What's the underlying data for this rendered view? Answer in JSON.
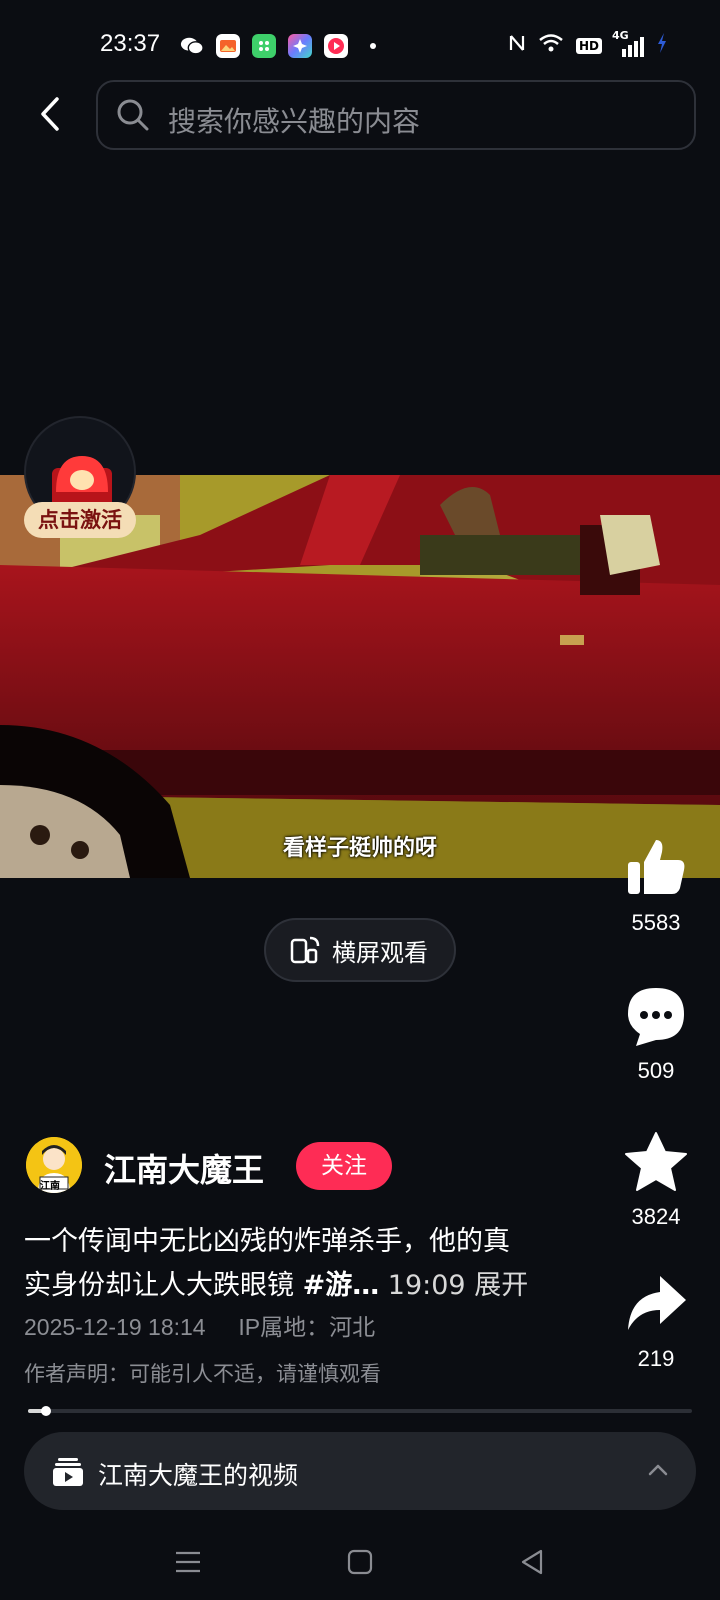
{
  "status_bar": {
    "time": "23:37",
    "network": "4G",
    "hd_label": "HD",
    "app_icons": [
      "wechat-icon",
      "gallery-icon",
      "grid-app-icon",
      "photos-icon",
      "video-app-icon"
    ]
  },
  "search": {
    "placeholder": "搜索你感兴趣的内容"
  },
  "activate_badge": {
    "label": "点击激活"
  },
  "video": {
    "subtitle": "看样子挺帅的呀"
  },
  "landscape_button": {
    "label": "横屏观看"
  },
  "actions": {
    "likes": "5583",
    "comments": "509",
    "favorites": "3824",
    "shares": "219"
  },
  "author": {
    "name": "江南大魔王",
    "follow_label": "关注",
    "avatar_text": "江南"
  },
  "description": {
    "line1": "一个传闻中无比凶残的炸弹杀手，他的真",
    "line2_text": "实身份却让人大跌眼镜 ",
    "hashtag": "#游…",
    "duration": " 19:09 ",
    "expand_label": "展开"
  },
  "meta": {
    "date": "2025-12-19 18:14",
    "ip_location": "IP属地：河北"
  },
  "notice": "作者声明：可能引人不适，请谨慎观看",
  "progress": {
    "fraction": 0.027
  },
  "collection": {
    "label": "江南大魔王的视频"
  },
  "colors": {
    "accent": "#fe2c55",
    "background": "#0b0d12"
  }
}
